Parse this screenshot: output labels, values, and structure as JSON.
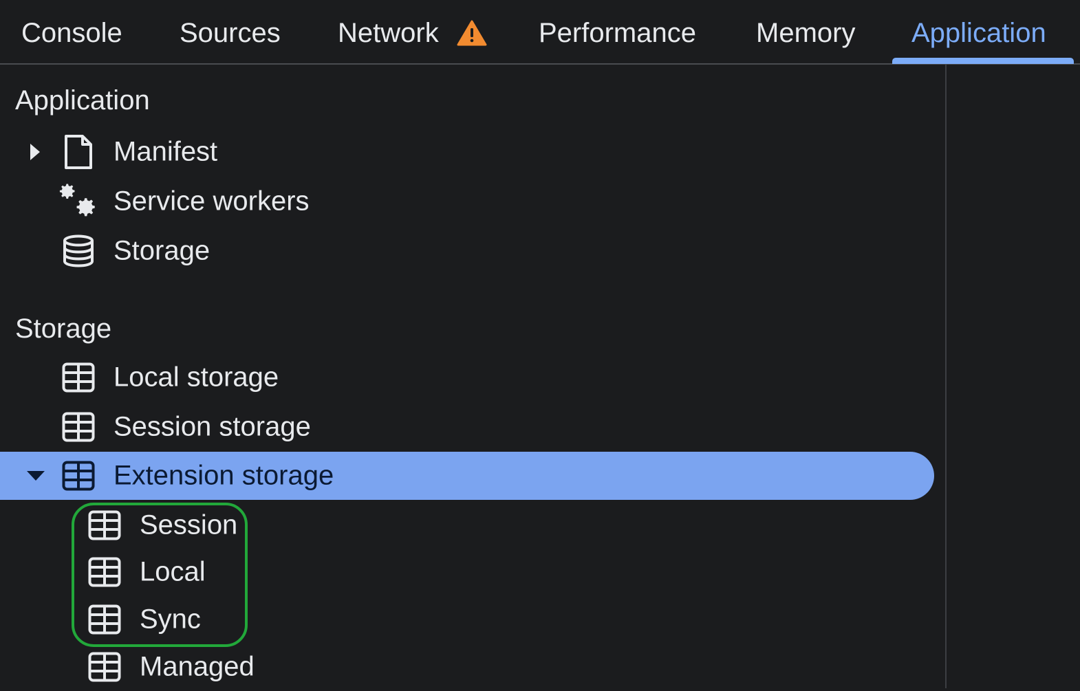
{
  "tabs": [
    {
      "label": "Console"
    },
    {
      "label": "Sources"
    },
    {
      "label": "Network"
    },
    {
      "label": "Performance"
    },
    {
      "label": "Memory"
    },
    {
      "label": "Application"
    }
  ],
  "active_tab": "Application",
  "colors": {
    "accent": "#7cacf8",
    "selected_row": "#7ba4f0",
    "warning": "#f28b30",
    "highlight_outline": "#22a83a",
    "background": "#1b1c1e"
  },
  "sidebar": {
    "application_section": {
      "title": "Application",
      "items": [
        {
          "label": "Manifest",
          "icon": "document-icon",
          "expandable": true
        },
        {
          "label": "Service workers",
          "icon": "gears-icon"
        },
        {
          "label": "Storage",
          "icon": "database-icon"
        }
      ]
    },
    "storage_section": {
      "title": "Storage",
      "items": [
        {
          "label": "Local storage",
          "icon": "table-icon"
        },
        {
          "label": "Session storage",
          "icon": "table-icon"
        },
        {
          "label": "Extension storage",
          "icon": "table-icon",
          "expanded": true,
          "selected": true
        }
      ],
      "extension_children": [
        {
          "label": "Session",
          "icon": "table-icon"
        },
        {
          "label": "Local",
          "icon": "table-icon"
        },
        {
          "label": "Sync",
          "icon": "table-icon"
        },
        {
          "label": "Managed",
          "icon": "table-icon"
        }
      ]
    }
  }
}
